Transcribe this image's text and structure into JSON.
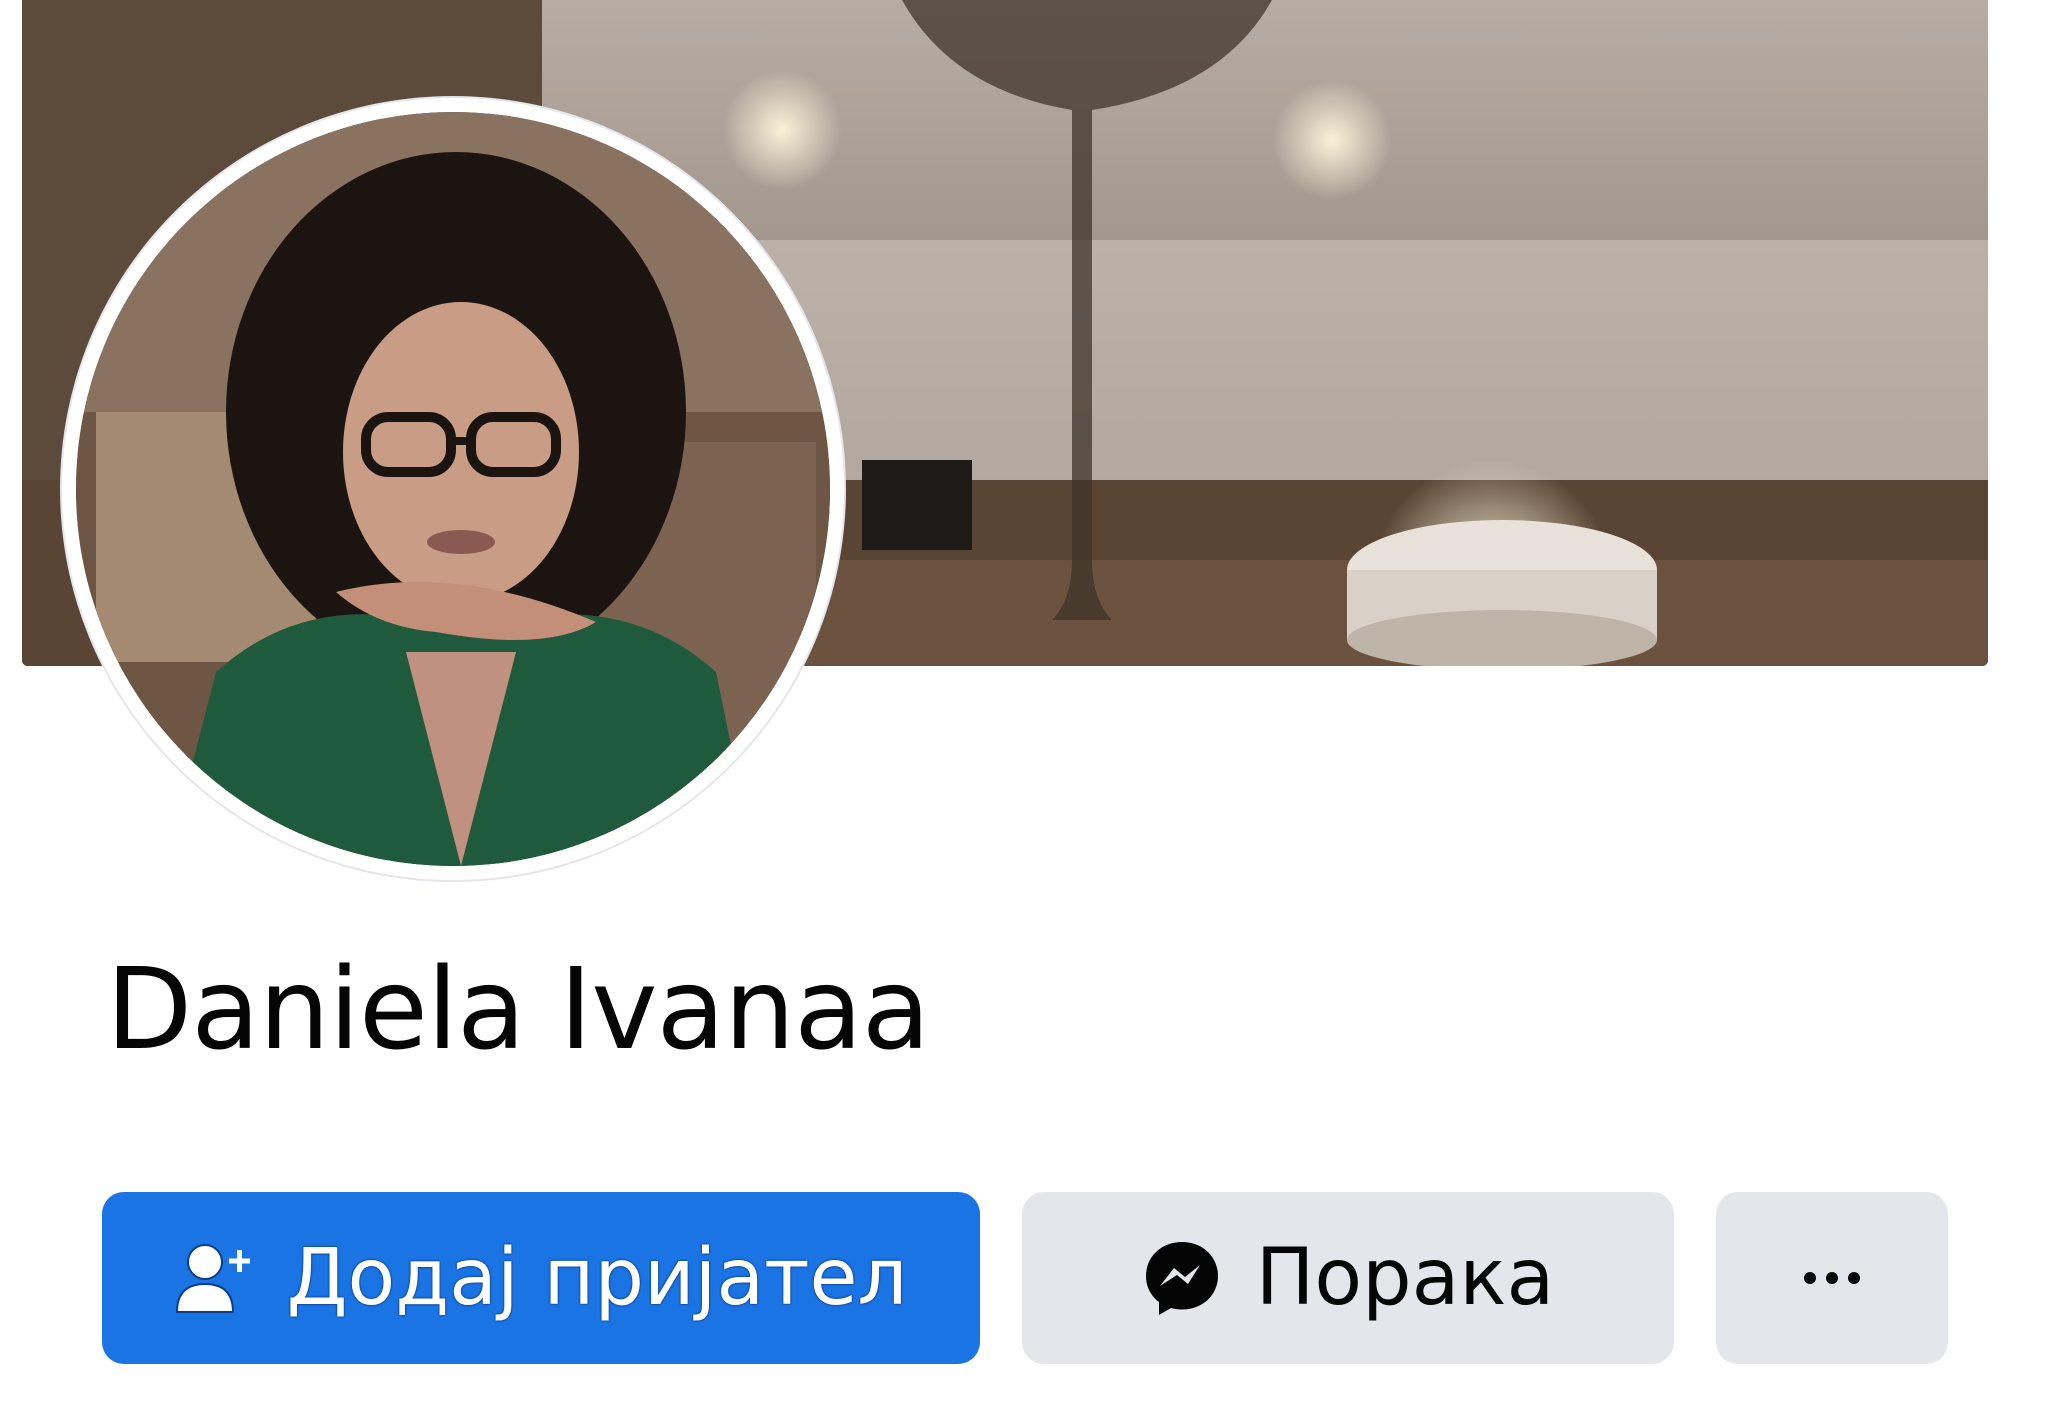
{
  "profile": {
    "name": "Daniela Ivanaa"
  },
  "actions": {
    "add_friend_label": "Додај пријател",
    "message_label": "Порака"
  },
  "icons": {
    "add_friend": "add-friend-icon",
    "messenger": "messenger-icon",
    "more": "more-options-icon"
  },
  "colors": {
    "primary": "#1b74e4",
    "secondary_button": "#e4e6eb",
    "text": "#050505",
    "background": "#ffffff"
  }
}
